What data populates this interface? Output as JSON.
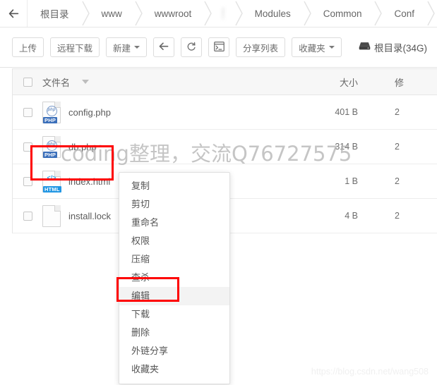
{
  "breadcrumb": {
    "back_icon": "arrow-left-icon",
    "segments": [
      {
        "label": "根目录",
        "type": "text"
      },
      {
        "label": "www",
        "type": "text"
      },
      {
        "label": "wwwroot",
        "type": "text"
      },
      {
        "label": "",
        "type": "blurred"
      },
      {
        "label": "Modules",
        "type": "text"
      },
      {
        "label": "Common",
        "type": "text"
      },
      {
        "label": "Conf",
        "type": "text"
      }
    ]
  },
  "toolbar": {
    "upload_label": "上传",
    "remote_download_label": "远程下载",
    "new_label": "新建",
    "back_icon": "arrow-left-icon",
    "refresh_icon": "refresh-icon",
    "terminal_icon": "terminal-icon",
    "share_list_label": "分享列表",
    "favorites_label": "收藏夹",
    "disk_icon": "hard-disk-icon",
    "disk_label": "根目录(34G)"
  },
  "table": {
    "headers": {
      "name": "文件名",
      "size": "大小",
      "mtime": "修"
    },
    "rows": [
      {
        "name": "config.php",
        "icon": "php-file-icon",
        "badge": "PHP",
        "size": "401 B",
        "mtime": "2"
      },
      {
        "name": "db.php",
        "icon": "php-file-icon",
        "badge": "PHP",
        "size": "314 B",
        "mtime": "2"
      },
      {
        "name": "index.html",
        "icon": "html-file-icon",
        "badge": "HTML",
        "size": "1 B",
        "mtime": "2"
      },
      {
        "name": "install.lock",
        "icon": "generic-file-icon",
        "badge": "",
        "size": "4 B",
        "mtime": "2"
      }
    ]
  },
  "context_menu": {
    "items": [
      {
        "label": "复制",
        "active": false
      },
      {
        "label": "剪切",
        "active": false
      },
      {
        "label": "重命名",
        "active": false
      },
      {
        "label": "权限",
        "active": false
      },
      {
        "label": "压缩",
        "active": false
      },
      {
        "label": "查杀",
        "active": false
      },
      {
        "label": "编辑",
        "active": true
      },
      {
        "label": "下载",
        "active": false
      },
      {
        "label": "删除",
        "active": false
      },
      {
        "label": "外链分享",
        "active": false
      },
      {
        "label": "收藏夹",
        "active": false
      }
    ]
  },
  "watermarks": {
    "main": "coding整理，交流Q76727575",
    "url": "https://blog.csdn.net/wang508"
  },
  "colors": {
    "annotation_red": "#fe0000",
    "php_badge": "#3b6fba",
    "html_badge": "#2196e3"
  }
}
